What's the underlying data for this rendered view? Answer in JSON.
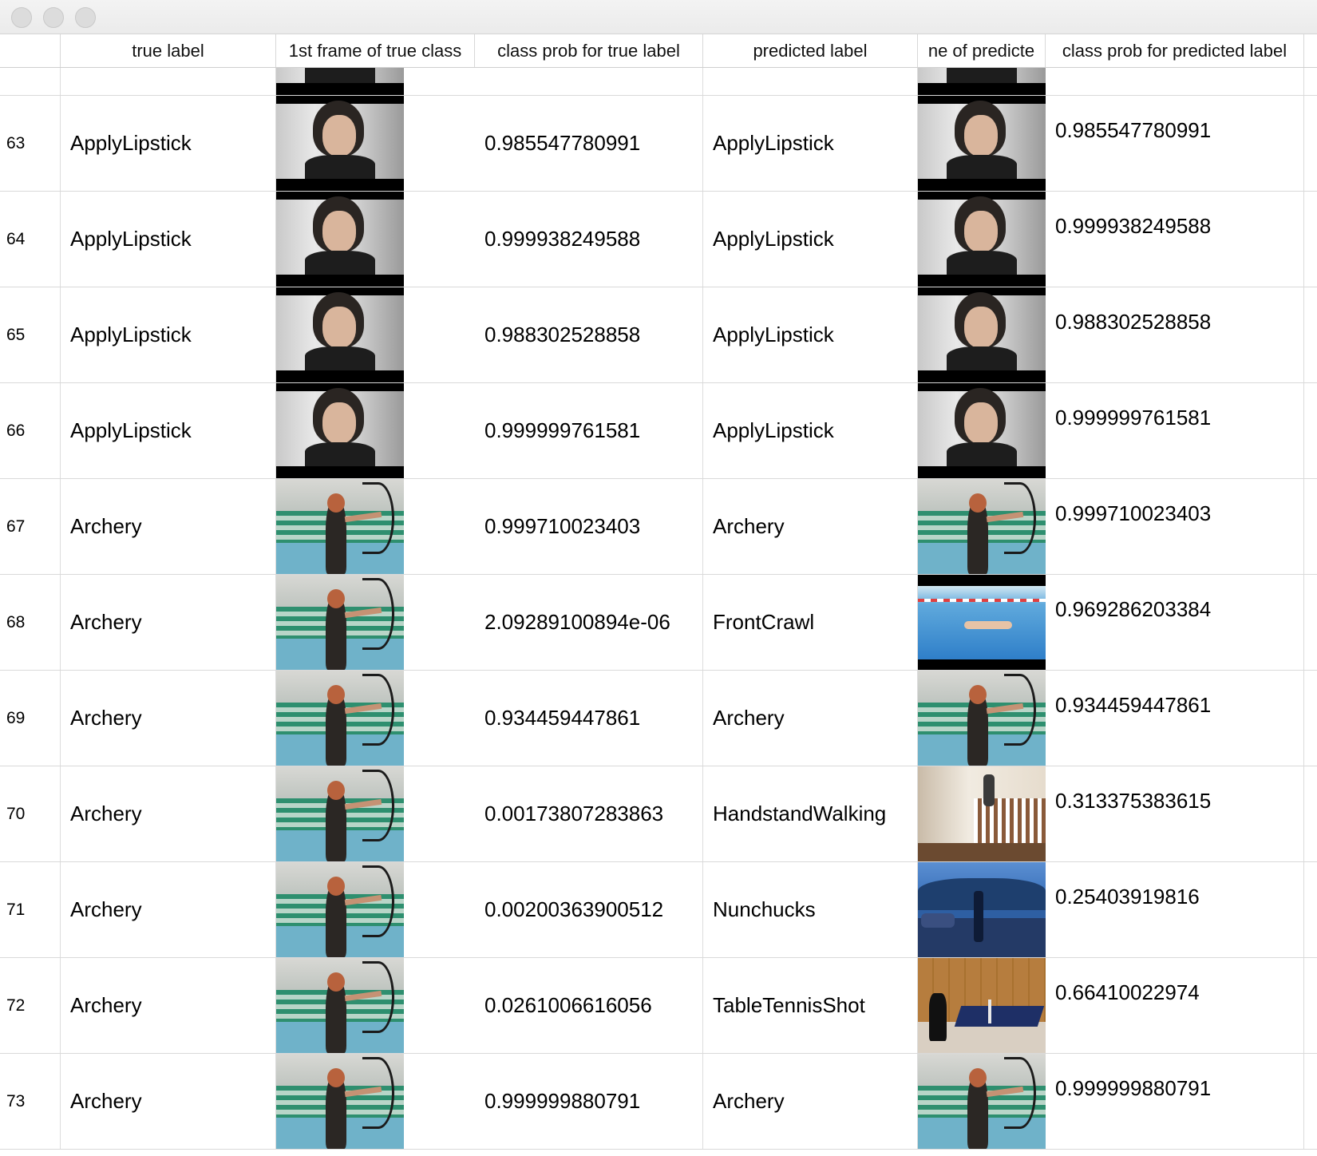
{
  "header": {
    "columns": [
      "",
      "true label",
      "1st frame of true class",
      "class prob for true label",
      "predicted label",
      "ne of predicte",
      "class prob for predicted label"
    ]
  },
  "rows": [
    {
      "index": "63",
      "true_label": "ApplyLipstick",
      "true_frame": "ApplyLipstick",
      "prob_true": "0.985547780991",
      "predicted_label": "ApplyLipstick",
      "pred_frame": "ApplyLipstick",
      "prob_pred": "0.985547780991"
    },
    {
      "index": "64",
      "true_label": "ApplyLipstick",
      "true_frame": "ApplyLipstick",
      "prob_true": "0.999938249588",
      "predicted_label": "ApplyLipstick",
      "pred_frame": "ApplyLipstick",
      "prob_pred": "0.999938249588"
    },
    {
      "index": "65",
      "true_label": "ApplyLipstick",
      "true_frame": "ApplyLipstick",
      "prob_true": "0.988302528858",
      "predicted_label": "ApplyLipstick",
      "pred_frame": "ApplyLipstick",
      "prob_pred": "0.988302528858"
    },
    {
      "index": "66",
      "true_label": "ApplyLipstick",
      "true_frame": "ApplyLipstick",
      "prob_true": "0.999999761581",
      "predicted_label": "ApplyLipstick",
      "pred_frame": "ApplyLipstick",
      "prob_pred": "0.999999761581"
    },
    {
      "index": "67",
      "true_label": "Archery",
      "true_frame": "Archery",
      "prob_true": "0.999710023403",
      "predicted_label": "Archery",
      "pred_frame": "Archery",
      "prob_pred": "0.999710023403"
    },
    {
      "index": "68",
      "true_label": "Archery",
      "true_frame": "Archery",
      "prob_true": "2.09289100894e-06",
      "predicted_label": "FrontCrawl",
      "pred_frame": "FrontCrawl",
      "prob_pred": "0.969286203384"
    },
    {
      "index": "69",
      "true_label": "Archery",
      "true_frame": "Archery",
      "prob_true": "0.934459447861",
      "predicted_label": "Archery",
      "pred_frame": "Archery",
      "prob_pred": "0.934459447861"
    },
    {
      "index": "70",
      "true_label": "Archery",
      "true_frame": "Archery",
      "prob_true": "0.00173807283863",
      "predicted_label": "HandstandWalking",
      "pred_frame": "HandstandWalking",
      "prob_pred": "0.313375383615"
    },
    {
      "index": "71",
      "true_label": "Archery",
      "true_frame": "Archery",
      "prob_true": "0.00200363900512",
      "predicted_label": "Nunchucks",
      "pred_frame": "Nunchucks",
      "prob_pred": "0.25403919816"
    },
    {
      "index": "72",
      "true_label": "Archery",
      "true_frame": "Archery",
      "prob_true": "0.0261006616056",
      "predicted_label": "TableTennisShot",
      "pred_frame": "TableTennisShot",
      "prob_pred": "0.66410022974"
    },
    {
      "index": "73",
      "true_label": "Archery",
      "true_frame": "Archery",
      "prob_true": "0.999999880791",
      "predicted_label": "Archery",
      "pred_frame": "Archery",
      "prob_pred": "0.999999880791"
    }
  ]
}
